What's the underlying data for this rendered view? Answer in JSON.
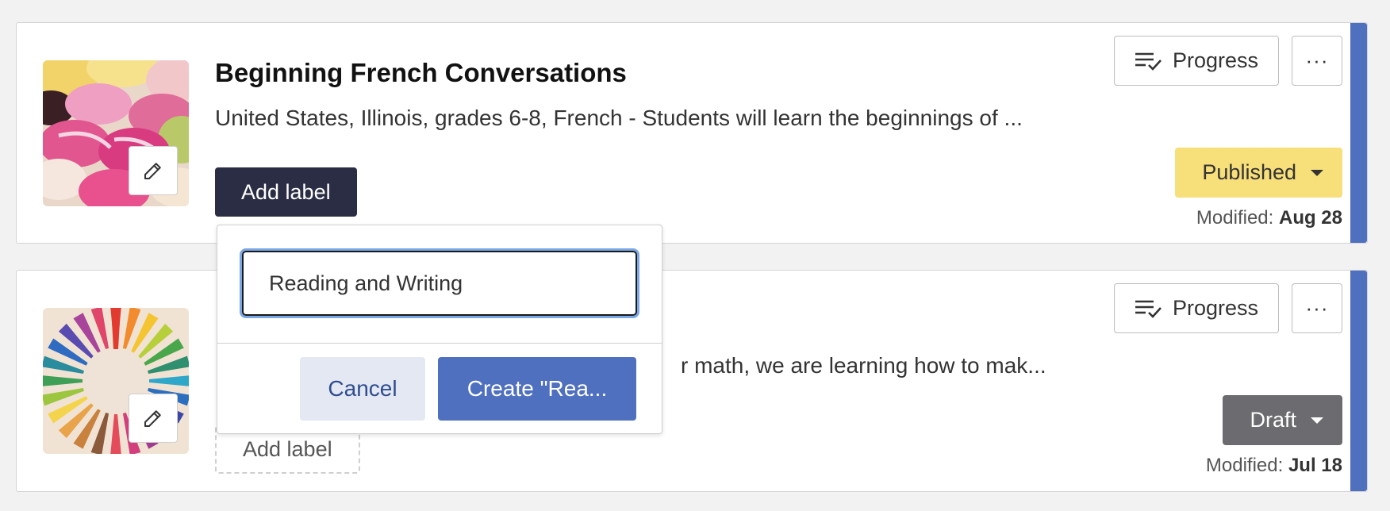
{
  "cards": [
    {
      "title": "Beginning French Conversations",
      "description": "United States, Illinois, grades 6-8, French - Students will learn the beginnings of ...",
      "add_label": "Add label",
      "progress_label": "Progress",
      "more_label": "···",
      "status": "Published",
      "modified_prefix": "Modified:",
      "modified_date": "Aug 28",
      "status_color": "#f7df7a",
      "thumbnail": "macarons-image"
    },
    {
      "title": "",
      "description": "r math, we are learning how to mak...",
      "add_label": "Add label",
      "progress_label": "Progress",
      "more_label": "···",
      "status": "Draft",
      "modified_prefix": "Modified:",
      "modified_date": "Jul 18",
      "status_color": "#6b6b70",
      "thumbnail": "colored-pencils-image"
    }
  ],
  "label_popover": {
    "input_value": "Reading and Writing",
    "cancel_label": "Cancel",
    "create_label": "Create \"Rea..."
  },
  "colors": {
    "accent": "#4f6fbf",
    "dark_button": "#2b2d45"
  }
}
